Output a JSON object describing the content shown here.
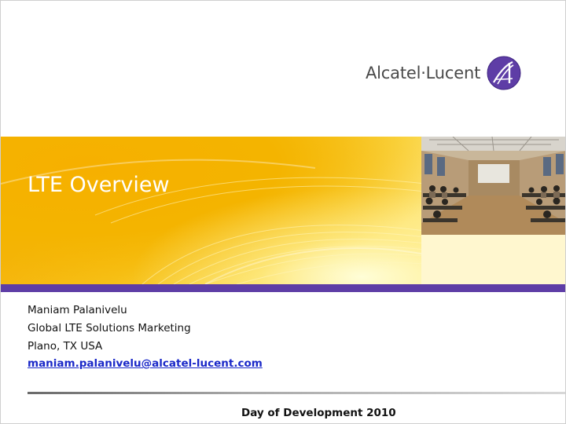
{
  "logo": {
    "wordmark": "Alcatel·Lucent",
    "icon": "alcatel-lucent-logo-icon",
    "color": "#4a4a4a",
    "mark_color": "#5e3da6"
  },
  "title": "LTE Overview",
  "photo": {
    "icon": "classroom-photo"
  },
  "presenter": {
    "name": "Maniam Palanivelu",
    "role": "Global LTE Solutions Marketing",
    "location": "Plano, TX USA",
    "email": "maniam.palanivelu@alcatel-lucent.com"
  },
  "footer": "Day of Development 2010",
  "colors": {
    "banner": "#f4b400",
    "accent_bar": "#5e3da6",
    "title_text": "#ffffff",
    "link": "#1a28c8"
  }
}
